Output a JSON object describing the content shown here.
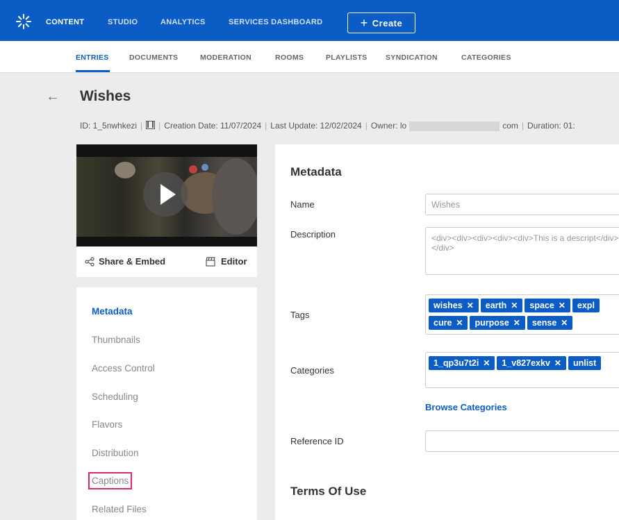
{
  "topnav": {
    "items": [
      "CONTENT",
      "STUDIO",
      "ANALYTICS",
      "SERVICES DASHBOARD"
    ],
    "create_label": "Create"
  },
  "subnav": {
    "items": [
      "ENTRIES",
      "DOCUMENTS",
      "MODERATION",
      "ROOMS",
      "PLAYLISTS",
      "SYNDICATION",
      "CATEGORIES"
    ]
  },
  "entry": {
    "title": "Wishes",
    "id": "ID: 1_5nwhkezi",
    "creation": "Creation Date: 11/07/2024",
    "update": "Last Update: 12/02/2024",
    "owner_prefix": "Owner: lo",
    "owner_suffix": "com",
    "duration": "Duration: 01:"
  },
  "thumb_actions": {
    "share": "Share & Embed",
    "editor": "Editor"
  },
  "side_menu": [
    "Metadata",
    "Thumbnails",
    "Access Control",
    "Scheduling",
    "Flavors",
    "Distribution",
    "Captions",
    "Related Files"
  ],
  "metadata": {
    "section_title": "Metadata",
    "name_label": "Name",
    "name_value": "Wishes",
    "description_label": "Description",
    "description_value": "<div><div><div><div><div>This is a descript</div></div>",
    "tags_label": "Tags",
    "tags": [
      "wishes",
      "earth",
      "space",
      "expl",
      "cure",
      "purpose",
      "sense"
    ],
    "categories_label": "Categories",
    "categories": [
      "1_qp3u7t2i",
      "1_v827exkv",
      "unlist"
    ],
    "browse_categories": "Browse Categories",
    "reference_label": "Reference ID",
    "reference_value": "",
    "terms_title": "Terms Of Use"
  },
  "colors": {
    "brand": "#0b5cc5",
    "highlight": "#e02374"
  }
}
